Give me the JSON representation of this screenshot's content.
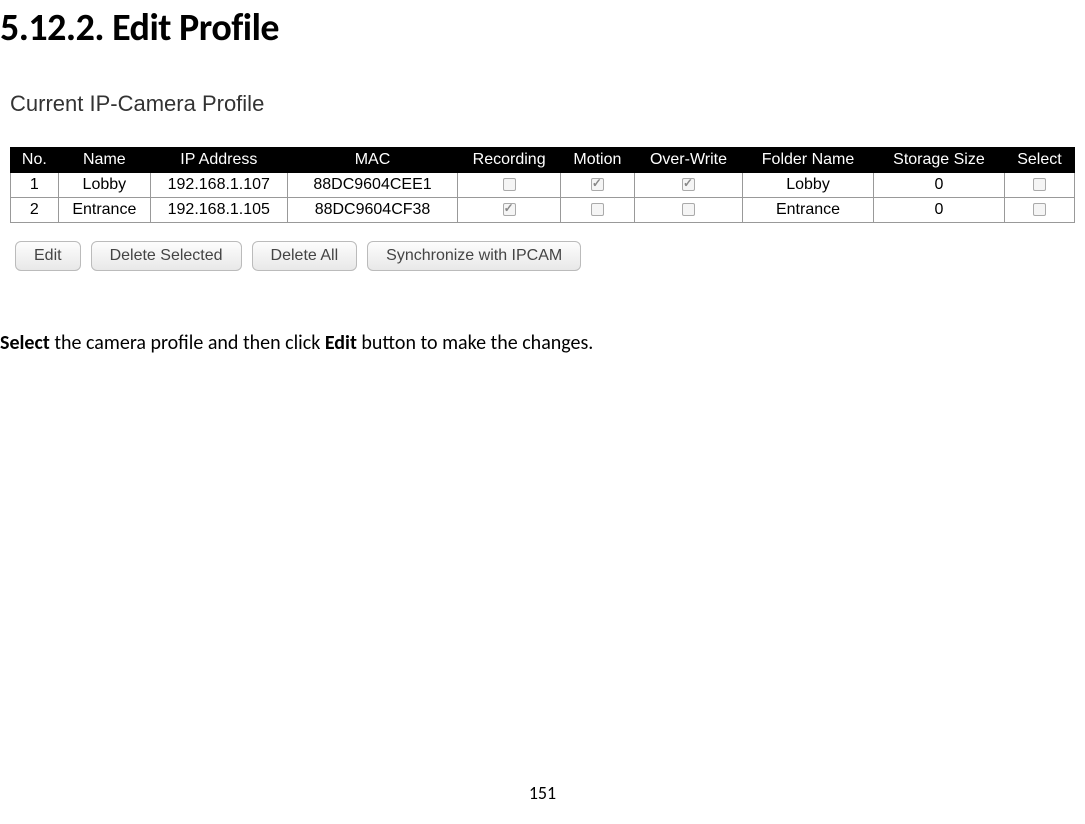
{
  "heading": "5.12.2. Edit Profile",
  "section_title": "Current IP-Camera Profile",
  "headers": {
    "no": "No.",
    "name": "Name",
    "ip": "IP Address",
    "mac": "MAC",
    "recording": "Recording",
    "motion": "Motion",
    "overwrite": "Over-Write",
    "folder": "Folder Name",
    "storage": "Storage Size",
    "select": "Select"
  },
  "rows": [
    {
      "no": "1",
      "name": "Lobby",
      "ip": "192.168.1.107",
      "mac": "88DC9604CEE1",
      "recording": false,
      "motion": true,
      "overwrite": true,
      "folder": "Lobby",
      "storage": "0",
      "select": false
    },
    {
      "no": "2",
      "name": "Entrance",
      "ip": "192.168.1.105",
      "mac": "88DC9604CF38",
      "recording": true,
      "motion": false,
      "overwrite": false,
      "folder": "Entrance",
      "storage": "0",
      "select": false
    }
  ],
  "buttons": {
    "edit": "Edit",
    "delete_selected": "Delete Selected",
    "delete_all": "Delete All",
    "sync": "Synchronize with IPCAM"
  },
  "instruction": {
    "pre": "Select",
    "mid1": " the camera profile and then click ",
    "bold2": "Edit",
    "mid2": " button to make the changes."
  },
  "page_number": "151"
}
